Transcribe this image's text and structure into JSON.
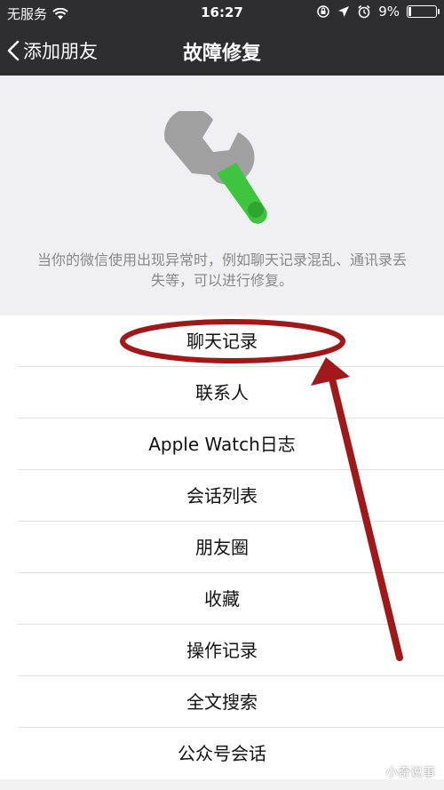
{
  "status_bar": {
    "carrier": "无服务",
    "time": "16:27",
    "battery": "9%",
    "battery_level": 0.09
  },
  "nav": {
    "back_label": "添加朋友",
    "title": "故障修复"
  },
  "header": {
    "description": "当你的微信使用出现异常时，例如聊天记录混乱、通讯录丢失等，可以进行修复。"
  },
  "menu": {
    "items": [
      {
        "label": "聊天记录"
      },
      {
        "label": "联系人"
      },
      {
        "label": "Apple Watch日志"
      },
      {
        "label": "会话列表"
      },
      {
        "label": "朋友圈"
      },
      {
        "label": "收藏"
      },
      {
        "label": "操作记录"
      },
      {
        "label": "全文搜索"
      },
      {
        "label": "公众号会话"
      }
    ]
  },
  "watermark": {
    "text": "小奇说事"
  },
  "colors": {
    "nav_background": "#2e2e30",
    "annotation": "#a01818",
    "wrench_handle": "#3ec43e"
  }
}
